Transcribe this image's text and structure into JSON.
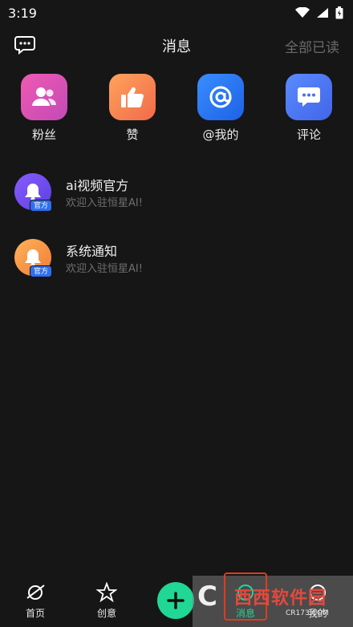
{
  "status": {
    "time": "3:19"
  },
  "header": {
    "title": "消息",
    "read_all": "全部已读"
  },
  "categories": [
    {
      "label": "粉丝",
      "icon": "fans-icon",
      "color": "#d94fa8"
    },
    {
      "label": "赞",
      "icon": "thumbs-up-icon",
      "color": "#f57a4e"
    },
    {
      "label": "@我的",
      "icon": "at-icon",
      "color": "#2a7af0"
    },
    {
      "label": "评论",
      "icon": "comment-icon",
      "color": "#4f73f0"
    }
  ],
  "messages": [
    {
      "name": "ai视频官方",
      "preview": "欢迎入驻恒星AI!",
      "badge": "官方",
      "avatar_color": "#6b4bf0"
    },
    {
      "name": "系统通知",
      "preview": "欢迎入驻恒星AI!",
      "badge": "官方",
      "avatar_color": "#f0902f"
    }
  ],
  "tabs": {
    "home": "首页",
    "create": "创意",
    "messages": "消息",
    "me": "我的"
  },
  "watermark": {
    "brand": "西西软件园",
    "site": "CR173.COM"
  }
}
